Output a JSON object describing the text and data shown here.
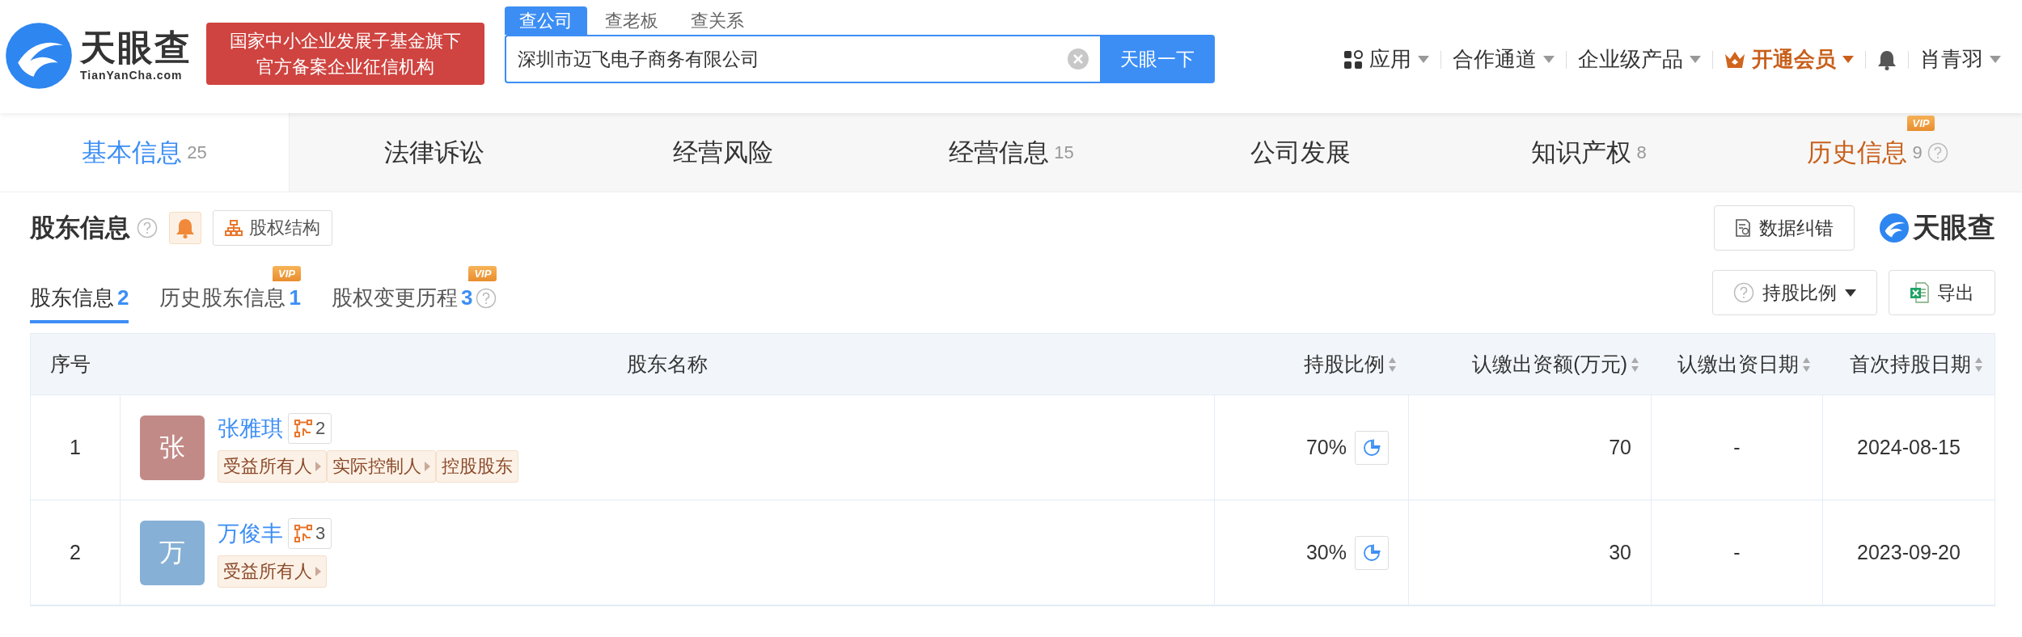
{
  "header": {
    "logo_text": "天眼查",
    "logo_domain": "TianYanCha.com",
    "badge_lines": [
      "国家中小企业发展子基金旗下",
      "官方备案企业征信机构"
    ],
    "search_tabs": [
      {
        "label": "查公司",
        "selected": true
      },
      {
        "label": "查老板",
        "selected": false
      },
      {
        "label": "查关系",
        "selected": false
      }
    ],
    "search": {
      "value": "深圳市迈飞电子商务有限公司",
      "button": "天眼一下"
    },
    "nav": [
      {
        "kind": "apps",
        "label": "应用"
      },
      {
        "kind": "plain",
        "label": "合作通道"
      },
      {
        "kind": "plain",
        "label": "企业级产品"
      },
      {
        "kind": "vip",
        "label": "开通会员"
      },
      {
        "kind": "bell"
      },
      {
        "kind": "plain",
        "label": "肖青羽"
      }
    ]
  },
  "tabs": [
    {
      "label": "基本信息",
      "count": "25",
      "selected": true
    },
    {
      "label": "法律诉讼",
      "selected": false
    },
    {
      "label": "经营风险",
      "selected": false
    },
    {
      "label": "经营信息",
      "count": "15",
      "selected": false
    },
    {
      "label": "公司发展",
      "selected": false
    },
    {
      "label": "知识产权",
      "count": "8",
      "selected": false
    },
    {
      "label": "历史信息",
      "count": "9",
      "selected": false,
      "badge": "VIP",
      "help": true
    }
  ],
  "section": {
    "title": "股东信息",
    "structure_button": "股权结构",
    "correction_button": "数据纠错",
    "brand": "天眼查",
    "subtabs": [
      {
        "label": "股东信息",
        "count": "2",
        "selected": true
      },
      {
        "label": "历史股东信息",
        "count": "1",
        "selected": false,
        "badge": "VIP"
      },
      {
        "label": "股权变更历程",
        "count": "3",
        "selected": false,
        "badge": "VIP",
        "help": true
      }
    ],
    "ratio_button": "持股比例",
    "export_button": "导出"
  },
  "table": {
    "columns": [
      {
        "label": "序号",
        "sortable": false
      },
      {
        "label": "股东名称",
        "sortable": false
      },
      {
        "label": "持股比例",
        "sortable": true
      },
      {
        "label": "认缴出资额(万元)",
        "sortable": true
      },
      {
        "label": "认缴出资日期",
        "sortable": true
      },
      {
        "label": "首次持股日期",
        "sortable": true
      }
    ],
    "rows": [
      {
        "index": "1",
        "avatar": "张",
        "color": "#c28a87",
        "name": "张雅琪",
        "links": "2",
        "tags": [
          {
            "label": "受益所有人",
            "arrow": true
          },
          {
            "label": "实际控制人",
            "arrow": true
          },
          {
            "label": "控股股东",
            "arrow": false
          }
        ],
        "ratio": "70%",
        "amount": "70",
        "date": "-",
        "first_date": "2024-08-15"
      },
      {
        "index": "2",
        "avatar": "万",
        "color": "#86b0d5",
        "name": "万俊丰",
        "links": "3",
        "tags": [
          {
            "label": "受益所有人",
            "arrow": true
          }
        ],
        "ratio": "30%",
        "amount": "30",
        "date": "-",
        "first_date": "2023-09-20"
      }
    ]
  }
}
